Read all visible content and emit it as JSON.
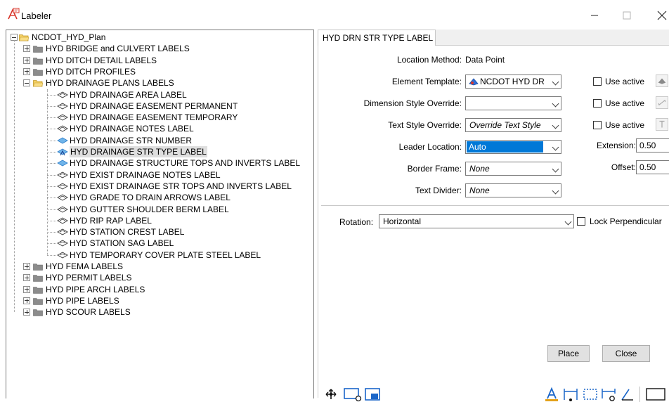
{
  "window": {
    "title": "Labeler",
    "controls": {
      "minimize_icon": "minimize-icon",
      "maximize_icon": "maximize-icon",
      "close_icon": "close-icon"
    }
  },
  "tree": {
    "root": "NCDOT_HYD_Plan",
    "groups_before": [
      "HYD BRIDGE and CULVERT LABELS",
      "HYD DITCH DETAIL LABELS",
      "HYD DITCH PROFILES"
    ],
    "open_group": "HYD DRAINAGE PLANS LABELS",
    "open_children": [
      "HYD DRAINAGE AREA LABEL",
      "HYD DRAINAGE EASEMENT PERMANENT",
      "HYD DRAINAGE EASEMENT TEMPORARY",
      "HYD DRAINAGE NOTES LABEL",
      "HYD DRAINAGE STR NUMBER",
      "HYD DRAINAGE STR TYPE LABEL",
      "HYD DRAINAGE STRUCTURE TOPS AND INVERTS LABEL",
      "HYD EXIST DRAINAGE NOTES LABEL",
      "HYD EXIST DRAINAGE STR TOPS AND INVERTS LABEL",
      "HYD GRADE TO DRAIN ARROWS LABEL",
      "HYD GUTTER SHOULDER BERM LABEL",
      "HYD RIP RAP LABEL",
      "HYD STATION CREST LABEL",
      "HYD STATION SAG LABEL",
      "HYD TEMPORARY COVER PLATE STEEL LABEL"
    ],
    "selected_child": "HYD DRAINAGE STR TYPE LABEL",
    "groups_after": [
      "HYD FEMA LABELS",
      "HYD PERMIT LABELS",
      "HYD PIPE ARCH LABELS",
      "HYD PIPE LABELS",
      "HYD SCOUR LABELS"
    ]
  },
  "panel": {
    "tab_label": "HYD DRN STR TYPE LABEL",
    "location_method_label": "Location Method:",
    "location_method_value": "Data Point",
    "element_template_label": "Element Template:",
    "element_template_value": "NCDOT HYD DR",
    "dimension_style_label": "Dimension Style Override:",
    "dimension_style_value": "",
    "text_style_label": "Text Style Override:",
    "text_style_value": "Override Text Style",
    "leader_location_label": "Leader Location:",
    "leader_location_value": "Auto",
    "border_frame_label": "Border Frame:",
    "border_frame_value": "None",
    "text_divider_label": "Text Divider:",
    "text_divider_value": "None",
    "use_active_1": "Use active",
    "use_active_2": "Use active",
    "use_active_3": "Use active",
    "extension_label": "Extension:",
    "extension_value": "0.50",
    "offset_label": "Offset:",
    "offset_value": "0.50",
    "rotation_label": "Rotation:",
    "rotation_value": "Horizontal",
    "lock_perpendicular_label": "Lock Perpendicular",
    "place_button": "Place",
    "close_button": "Close"
  },
  "colors": {
    "accent_blue": "#0078d7",
    "folder_yellow": "#e8c44a",
    "tree_selection": "#dedede"
  }
}
